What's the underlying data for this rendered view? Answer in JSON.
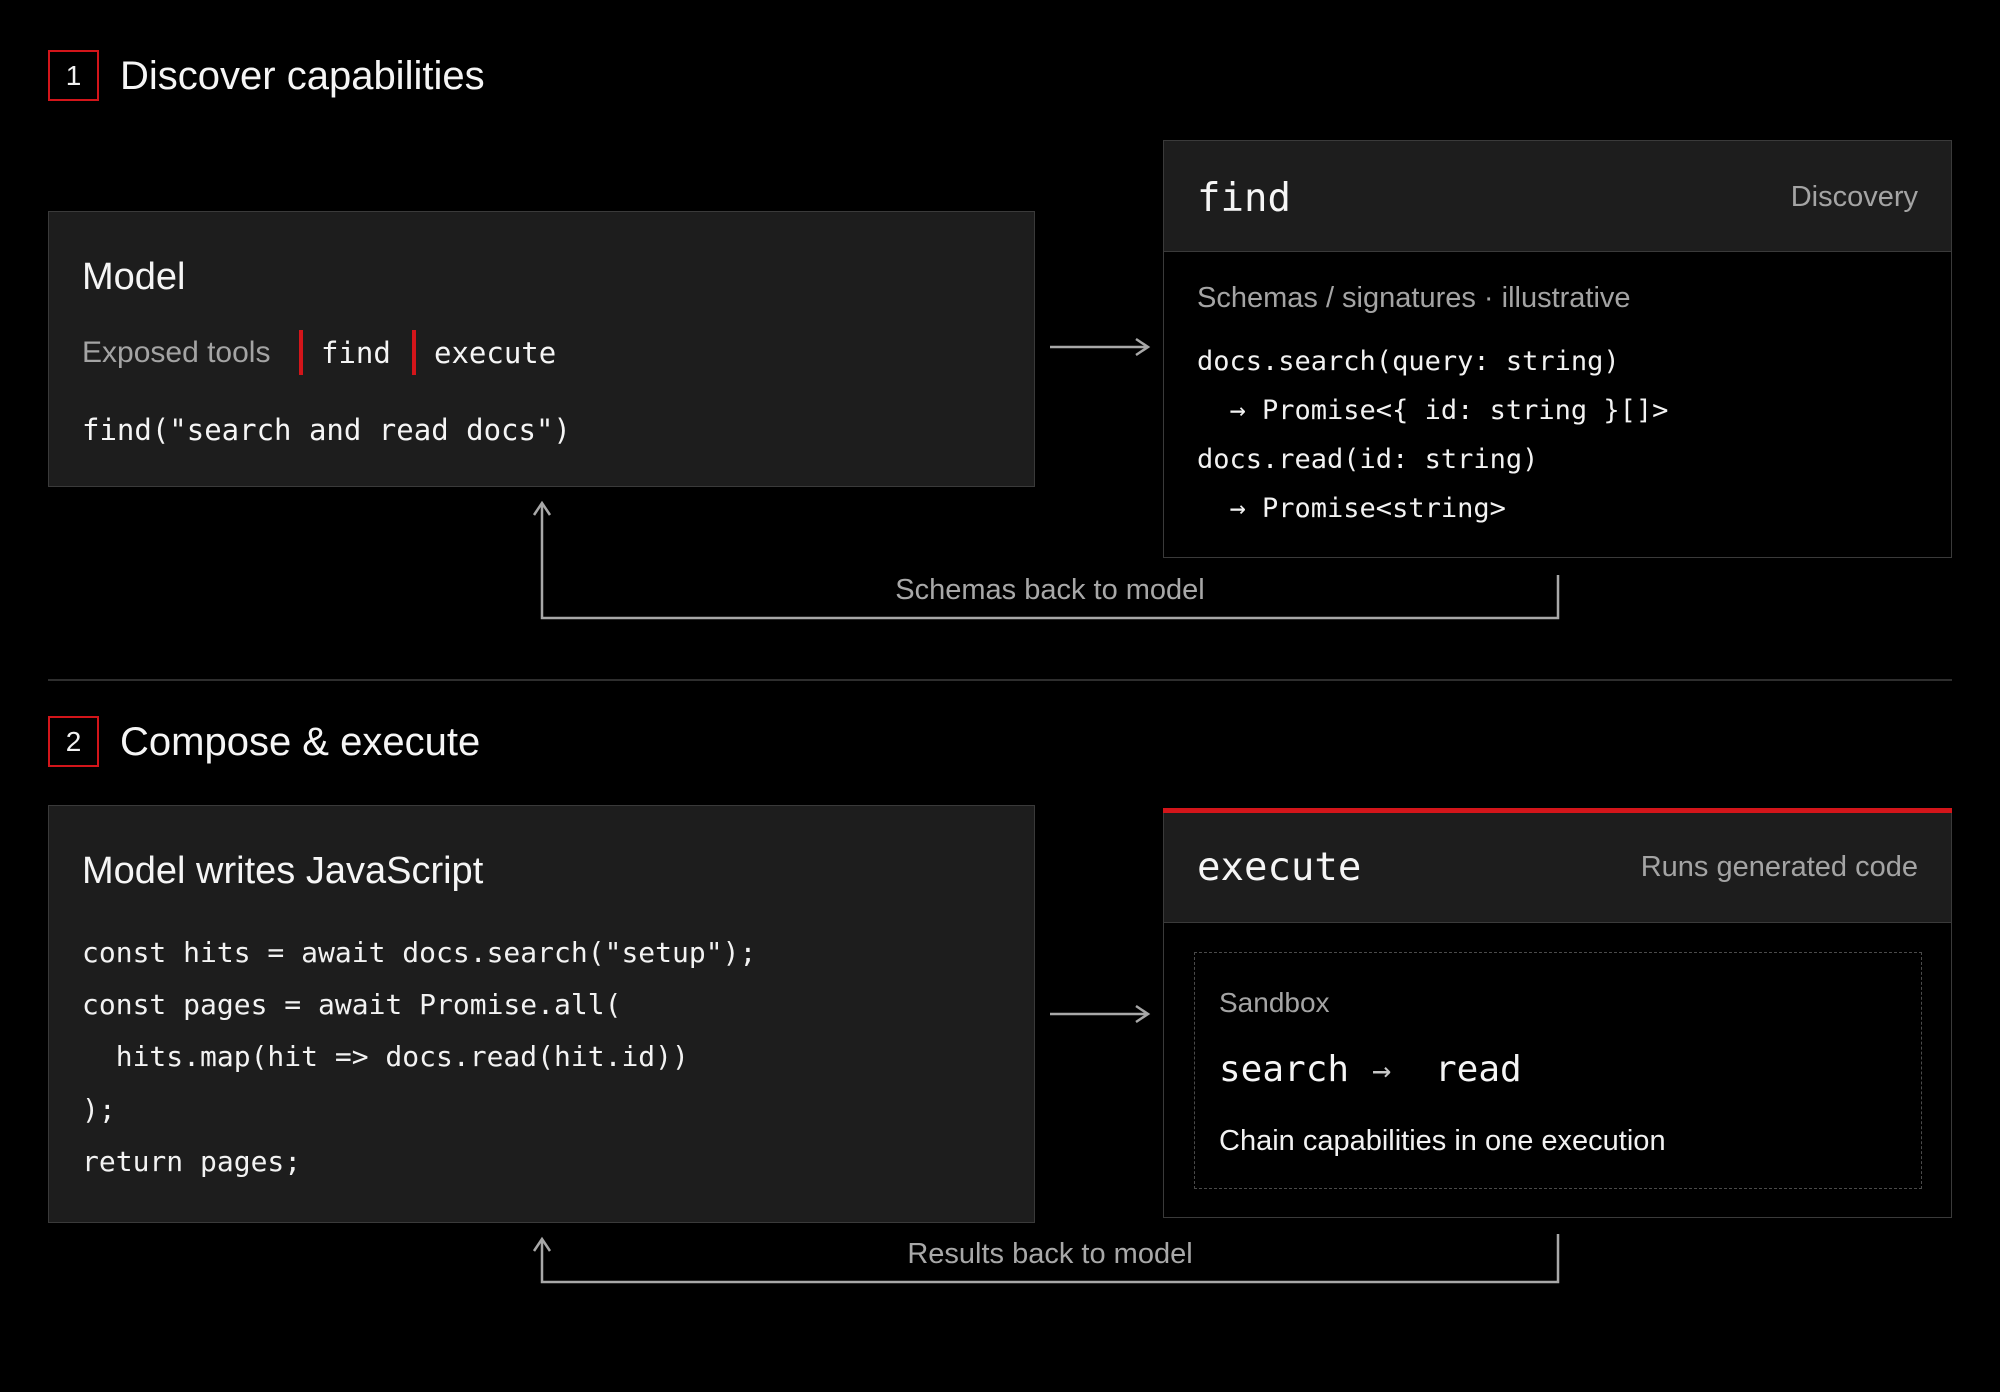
{
  "step1": {
    "number": "1",
    "title": "Discover capabilities",
    "model_box": {
      "title": "Model",
      "exposed_label": "Exposed tools",
      "tool_find": "find",
      "tool_execute": "execute",
      "call": "find(\"search and read docs\")"
    },
    "find_box": {
      "name": "find",
      "tag": "Discovery",
      "subtitle": "Schemas / signatures · illustrative",
      "lines": [
        "docs.search(query: string)",
        "  → Promise<{ id: string }[]>",
        "docs.read(id: string)",
        "  → Promise<string>"
      ]
    },
    "return_label": "Schemas back to model"
  },
  "step2": {
    "number": "2",
    "title": "Compose & execute",
    "model_box": {
      "title": "Model writes JavaScript",
      "code": [
        "const hits = await docs.search(\"setup\");",
        "const pages = await Promise.all(",
        "  hits.map(hit => docs.read(hit.id))",
        ");",
        "return pages;"
      ]
    },
    "execute_box": {
      "name": "execute",
      "tag": "Runs generated code",
      "sandbox_label": "Sandbox",
      "chain_from": "search",
      "chain_arrow": "→",
      "chain_to": "read",
      "caption": "Chain capabilities in one execution"
    },
    "return_label": "Results back to model"
  },
  "colors": {
    "background": "#000000",
    "panel": "#1d1d1d",
    "accent_red": "#d3151a",
    "border": "#3a3a3a",
    "muted_text": "#a4a4a4",
    "connector": "#a8a8a8"
  }
}
